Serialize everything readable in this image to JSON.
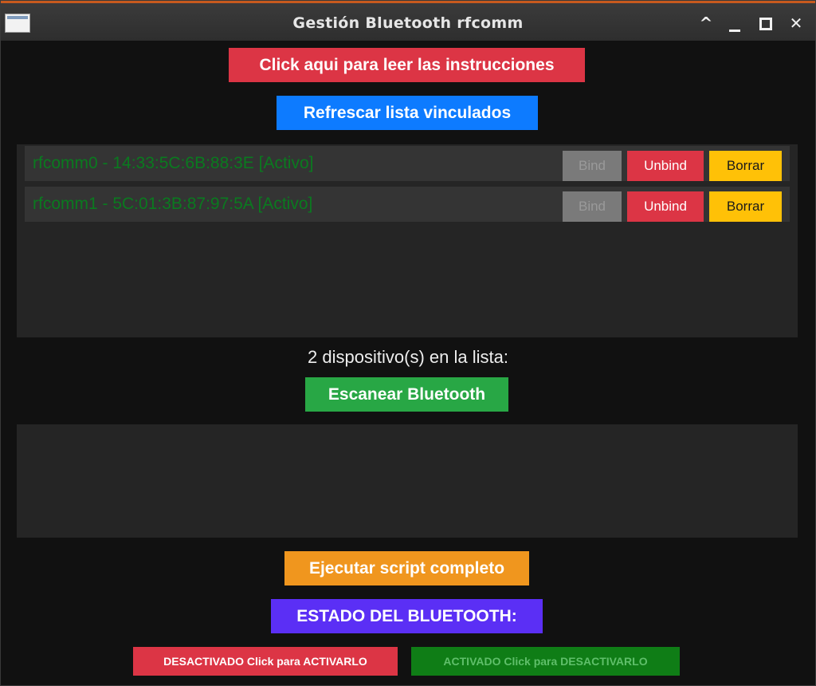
{
  "window": {
    "title": "Gestión Bluetooth rfcomm",
    "controls": {
      "collapse": "^",
      "close": "✕"
    }
  },
  "buttons": {
    "instructions": "Click aqui para leer las instrucciones",
    "refresh": "Refrescar lista vinculados",
    "scan": "Escanear Bluetooth",
    "run_script": "Ejecutar script completo",
    "bt_status": "ESTADO DEL BLUETOOTH:"
  },
  "devices": [
    {
      "label": "rfcomm0 - 14:33:5C:6B:88:3E [Activo]",
      "bind": "Bind",
      "unbind": "Unbind",
      "delete": "Borrar"
    },
    {
      "label": "rfcomm1 - 5C:01:3B:87:97:5A [Activo]",
      "bind": "Bind",
      "unbind": "Unbind",
      "delete": "Borrar"
    }
  ],
  "device_count_label": "2 dispositivo(s) en la lista:",
  "status": {
    "deactivated": "DESACTIVADO Click para ACTIVARLO",
    "activated": "ACTIVADO Click para DESACTIVARLO"
  },
  "colors": {
    "red": "#dc3545",
    "blue": "#0d7bff",
    "green": "#28a745",
    "orange": "#f0961e",
    "purple": "#5b2ff5",
    "yellow": "#ffc107",
    "gray_disabled": "#7a7a7a",
    "dark_green": "#0f7d16",
    "device_text": "#0a7a1f"
  }
}
